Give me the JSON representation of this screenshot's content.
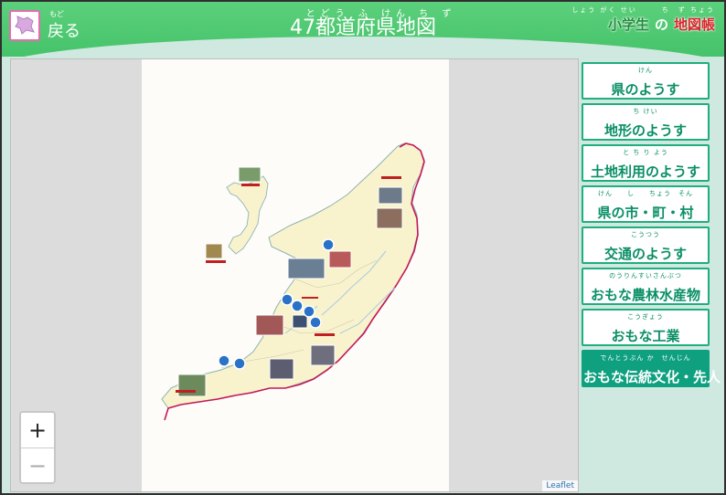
{
  "header": {
    "back_ruby": "もど",
    "back_label": "戻る",
    "title_ruby": "とどう ふ けん ち ず",
    "title": "47都道府県地図",
    "brand_ruby": "しょう がく せい　　　ち　ず ちょう",
    "brand_sho": "小学生",
    "brand_no": "の",
    "brand_chizu": "地図帳",
    "icon": "hokkaido-icon"
  },
  "map": {
    "zoom_in": "+",
    "zoom_out": "−",
    "attribution": "Leaflet"
  },
  "menu": [
    {
      "ruby": "けん",
      "label": "県のようす",
      "active": false
    },
    {
      "ruby": "ち けい",
      "label": "地形のようす",
      "active": false
    },
    {
      "ruby": "と ち り よう",
      "label": "土地利用のようす",
      "active": false
    },
    {
      "ruby": "けん　　し　　ちょう　そん",
      "label": "県の市・町・村",
      "active": false
    },
    {
      "ruby": "こうつう",
      "label": "交通のようす",
      "active": false
    },
    {
      "ruby": "のうりんすいさんぶつ",
      "label": "おもな農林水産物",
      "active": false
    },
    {
      "ruby": "こうぎょう",
      "label": "おもな工業",
      "active": false
    },
    {
      "ruby": "でんとうぶん か　せんじん",
      "label": "おもな伝統文化・先人",
      "active": true
    }
  ],
  "colors": {
    "header_green": "#45c36a",
    "menu_teal": "#0fa080",
    "border_pink": "#c2185b"
  }
}
